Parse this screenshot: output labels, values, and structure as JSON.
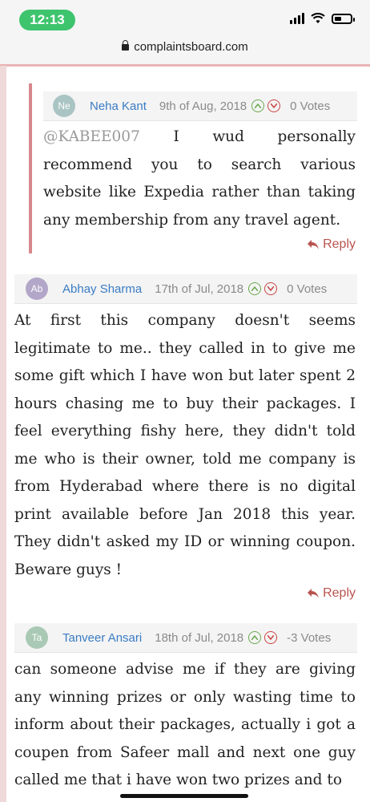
{
  "status_bar": {
    "time": "12:13",
    "battery_level": 0.45
  },
  "browser": {
    "url": "complaintsboard.com"
  },
  "comments": [
    {
      "initials": "Ne",
      "avatar_color": "#a9c4c3",
      "author": "Neha Kant",
      "date": "9th of Aug, 2018",
      "votes": "0 Votes",
      "mention": "@KABEE007",
      "text": "I wud personally recommend you to search various website like Expedia rather than taking any membership from any travel agent.",
      "reply_label": "Reply",
      "is_reply": true
    },
    {
      "initials": "Ab",
      "avatar_color": "#b3a7c9",
      "author": "Abhay Sharma",
      "date": "17th of Jul, 2018",
      "votes": "0 Votes",
      "text": "At first this company doesn't seems legitimate to me.. they called in to give me some gift which I have won but later spent 2 hours chasing me to buy their packages. I feel everything fishy here, they didn't told me who is their owner, told me company is from Hyderabad where there is no digital print available before Jan 2018 this year. They didn't asked my ID or winning coupon. Beware guys !",
      "reply_label": "Reply"
    },
    {
      "initials": "Ta",
      "avatar_color": "#a9c9b4",
      "author": "Tanveer Ansari",
      "date": "18th of Jul, 2018",
      "votes": "-3 Votes",
      "text": "can someone advise me if they are giving any winning prizes or only wasting time to inform about their packages, actually i got a coupen from Safeer mall and next one guy called me that i have won two prizes and to"
    }
  ],
  "colors": {
    "accent": "#b8544f",
    "author_link": "#3a7cc4",
    "thread_line": "#d8888c"
  }
}
